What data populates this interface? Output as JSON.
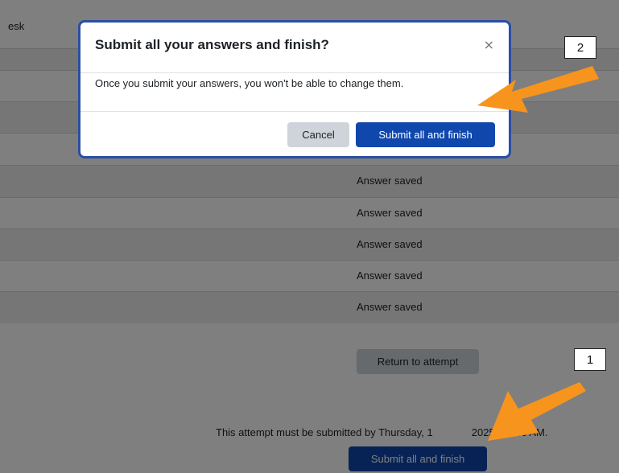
{
  "header": {
    "partial_text": "esk"
  },
  "summary": {
    "rows": [
      {
        "status": ""
      },
      {
        "status": ""
      },
      {
        "status": ""
      },
      {
        "status": ""
      },
      {
        "status": "Answer saved"
      },
      {
        "status": "Answer saved"
      },
      {
        "status": "Answer saved"
      },
      {
        "status": "Answer saved"
      },
      {
        "status": "Answer saved"
      }
    ]
  },
  "actions": {
    "return_label": "Return to attempt",
    "deadline_text": "This attempt must be submitted by Thursday, 1",
    "deadline_tail": "2025, 10:46 AM.",
    "submit_label": "Submit all and finish"
  },
  "modal": {
    "title": "Submit all your answers and finish?",
    "close_glyph": "×",
    "body": "Once you submit your answers, you won't be able to change them.",
    "cancel_label": "Cancel",
    "submit_label": "Submit all and finish"
  },
  "annotations": {
    "callout_1": "1",
    "callout_2": "2",
    "arrow_color": "#f7941d"
  },
  "colors": {
    "primary": "#0f47ad",
    "secondary": "#ced4da",
    "modal_border": "#2a4fa3"
  }
}
